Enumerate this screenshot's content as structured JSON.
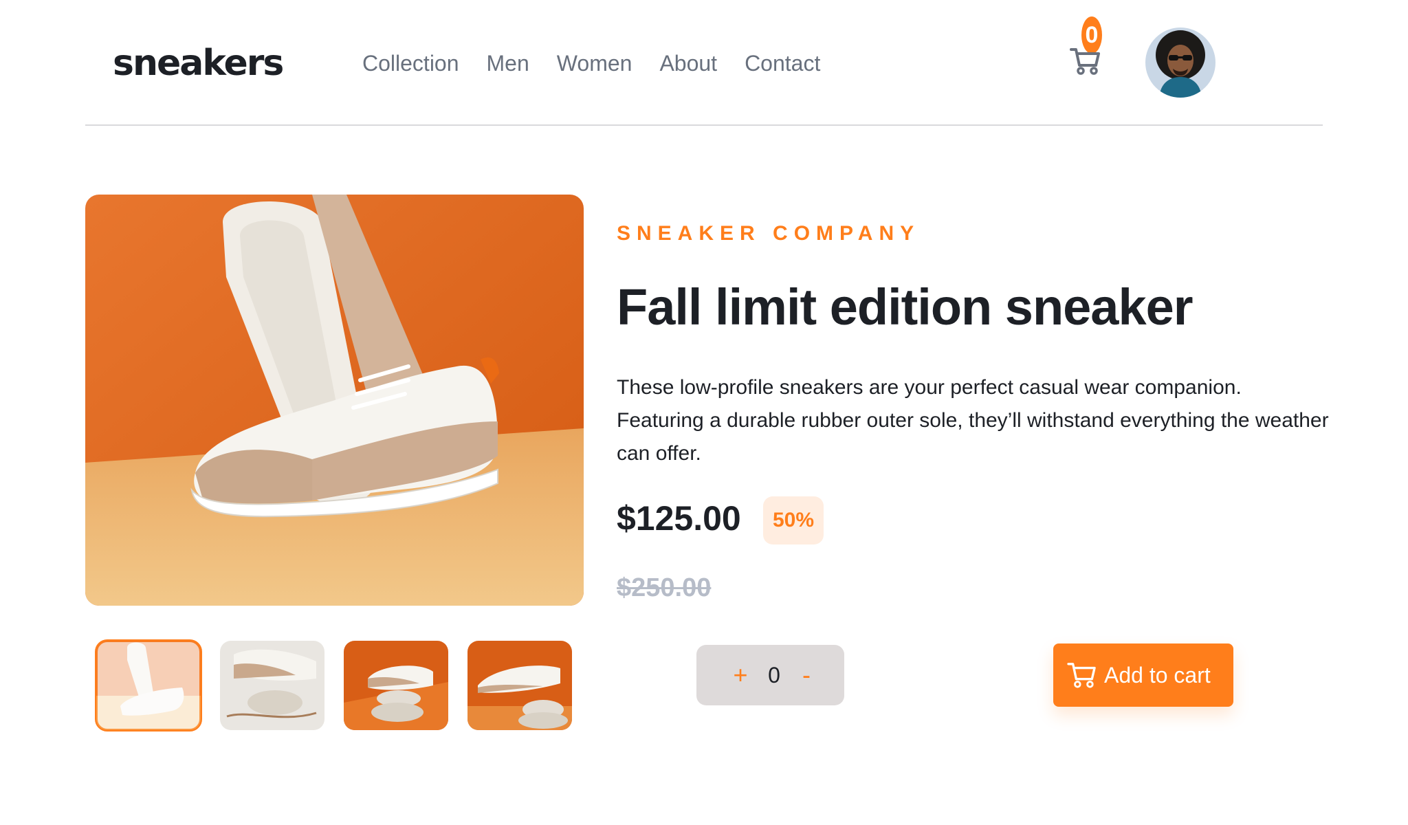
{
  "brand": {
    "logo": "sneakers"
  },
  "nav": {
    "items": [
      {
        "label": "Collection"
      },
      {
        "label": "Men"
      },
      {
        "label": "Women"
      },
      {
        "label": "About"
      },
      {
        "label": "Contact"
      }
    ]
  },
  "cart": {
    "count": "0",
    "icon": "cart-icon"
  },
  "user": {
    "avatar": "avatar"
  },
  "product": {
    "company": "SNEAKER COMPANY",
    "title": "Fall limit edition sneaker",
    "description": "These low-profile sneakers are your perfect casual wear companion. Featuring a durable rubber outer sole, they’ll withstand everything the weather can offer.",
    "price": "$125.00",
    "discount": "50%",
    "original_price": "$250.00",
    "quantity": "0",
    "qty_plus": "+",
    "qty_minus": "-",
    "add_to_cart": "Add to cart",
    "thumbnails_count": 4,
    "active_thumbnail": 1
  },
  "colors": {
    "accent": "#ff7e1b",
    "accent_pale": "#ffede0",
    "text_dark": "#1d2026",
    "text_muted": "#68707d",
    "strike": "#b6bcc8",
    "qty_bg": "#dedada"
  }
}
